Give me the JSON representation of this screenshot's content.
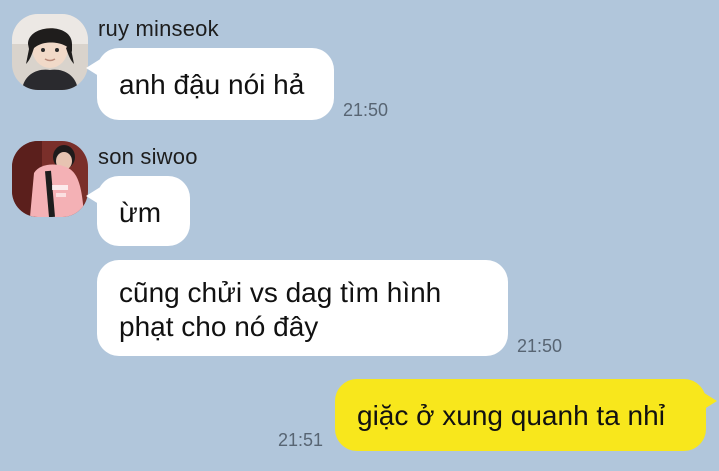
{
  "colors": {
    "background": "#b1c6db",
    "incoming_bubble": "#ffffff",
    "outgoing_bubble": "#f8e71c"
  },
  "messages": {
    "m1": {
      "sender": "ruy minseok",
      "avatar_icon": "profile-photo-icon",
      "text": "anh đậu nói hả",
      "time": "21:50"
    },
    "m2": {
      "sender": "son siwoo",
      "avatar_icon": "profile-photo-icon",
      "text_1": "ừm",
      "text_2": "cũng chửi vs dag tìm hình\nphạt cho nó đây",
      "time": "21:50"
    },
    "m3": {
      "text": "giặc ở xung quanh ta nhỉ",
      "time": "21:51"
    }
  }
}
